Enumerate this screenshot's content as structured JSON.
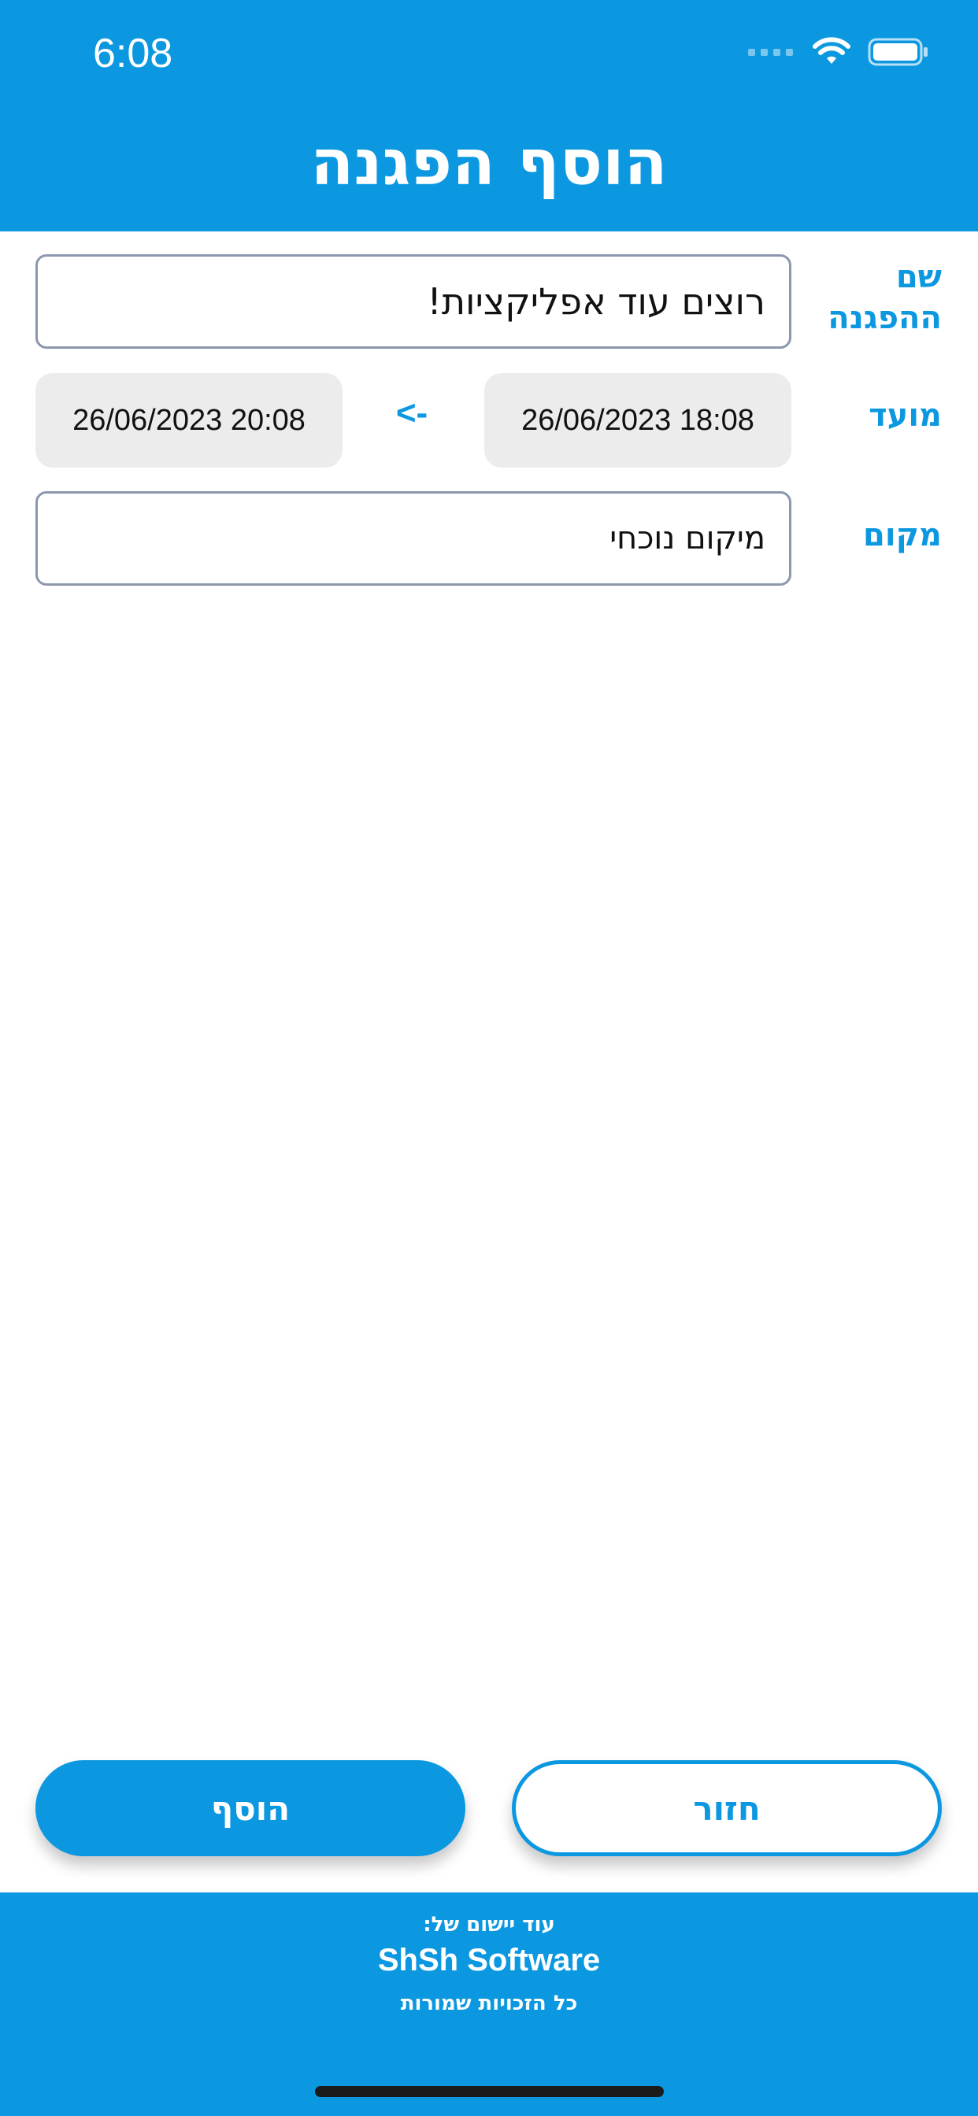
{
  "status_bar": {
    "time": "6:08",
    "icons": [
      "signal-dots-icon",
      "wifi-icon",
      "battery-icon"
    ]
  },
  "header": {
    "title": "הוסף הפגנה"
  },
  "form": {
    "name_label": "שם ההפגנה",
    "name_value": "רוצים עוד אפליקציות!",
    "time_label": "מועד",
    "start_date": "26/06/2023 18:08",
    "arrow": "<-",
    "end_date": "26/06/2023 20:08",
    "location_label": "מקום",
    "location_value": "מיקום נוכחי"
  },
  "buttons": {
    "back_label": "חזור",
    "add_label": "הוסף"
  },
  "footer": {
    "line1": "עוד יישום של:",
    "company": "ShSh Software",
    "line3": "כל הזכויות שמורות"
  },
  "colors": {
    "accent": "#0c98e0",
    "field_border": "#8b97ad",
    "date_background": "#ececec"
  }
}
